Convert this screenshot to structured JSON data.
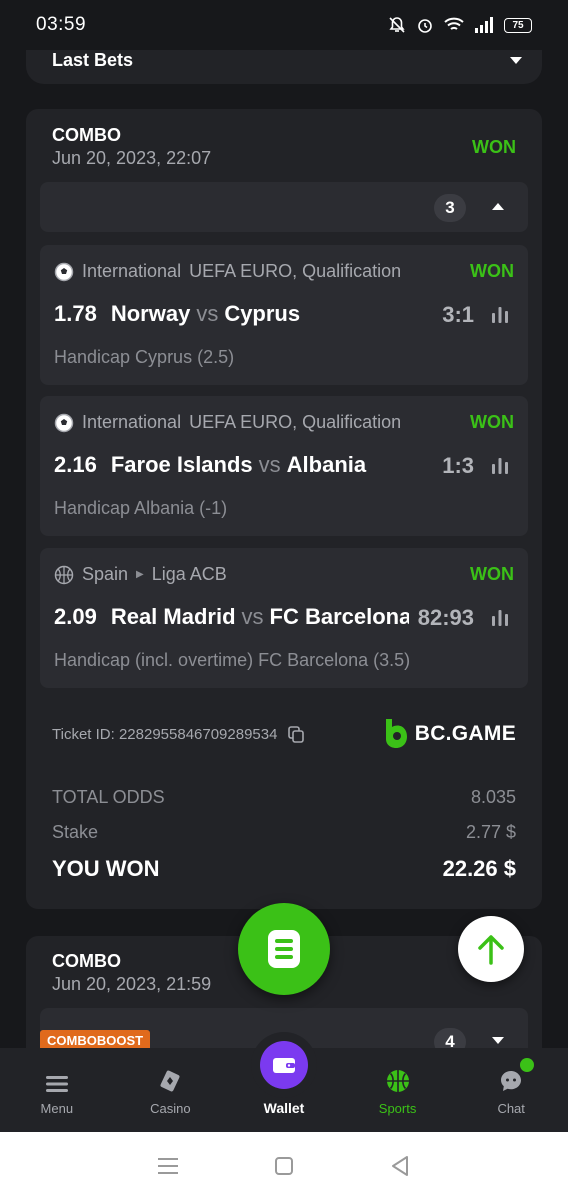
{
  "status": {
    "time": "03:59",
    "battery": "75"
  },
  "header": {
    "title": "Last Bets"
  },
  "ticket1": {
    "type": "COMBO",
    "date": "Jun 20, 2023, 22:07",
    "status": "WON",
    "selections_count": "3",
    "bets": [
      {
        "league_country": "International",
        "league_name": "UEFA EURO, Qualification",
        "status": "WON",
        "odds": "1.78",
        "home": "Norway",
        "vs": "vs",
        "away": "Cyprus",
        "score": "3:1",
        "market": "Handicap Cyprus (2.5)",
        "sport_icon": "soccer-ball-icon"
      },
      {
        "league_country": "International",
        "league_name": "UEFA EURO, Qualification",
        "status": "WON",
        "odds": "2.16",
        "home": "Faroe Islands",
        "vs": "vs",
        "away": "Albania",
        "score": "1:3",
        "market": "Handicap Albania (-1)",
        "sport_icon": "soccer-ball-icon"
      },
      {
        "league_country": "Spain",
        "league_name": "Liga ACB",
        "status": "WON",
        "odds": "2.09",
        "home": "Real Madrid",
        "vs": "vs",
        "away": "FC Barcelona",
        "score": "82:93",
        "market": "Handicap (incl. overtime) FC Barcelona (3.5)",
        "sport_icon": "basketball-icon"
      }
    ],
    "ticket_id_label": "Ticket ID: 2282955846709289534",
    "brand": "BC.GAME",
    "total_odds_label": "TOTAL ODDS",
    "total_odds": "8.035",
    "stake_label": "Stake",
    "stake": "2.77 $",
    "won_label": "YOU WON",
    "won_amount": "22.26 $"
  },
  "ticket2": {
    "type": "COMBO",
    "date": "Jun 20, 2023, 21:59",
    "badge": "COMBOBOOST",
    "selections_count": "4"
  },
  "nav": {
    "items": [
      {
        "label": "Menu"
      },
      {
        "label": "Casino"
      },
      {
        "label": "Wallet"
      },
      {
        "label": "Sports"
      },
      {
        "label": "Chat"
      }
    ]
  },
  "colors": {
    "accent_green": "#3bc117",
    "wallet_purple": "#7b3af0",
    "boost_orange": "#e06a1c"
  }
}
